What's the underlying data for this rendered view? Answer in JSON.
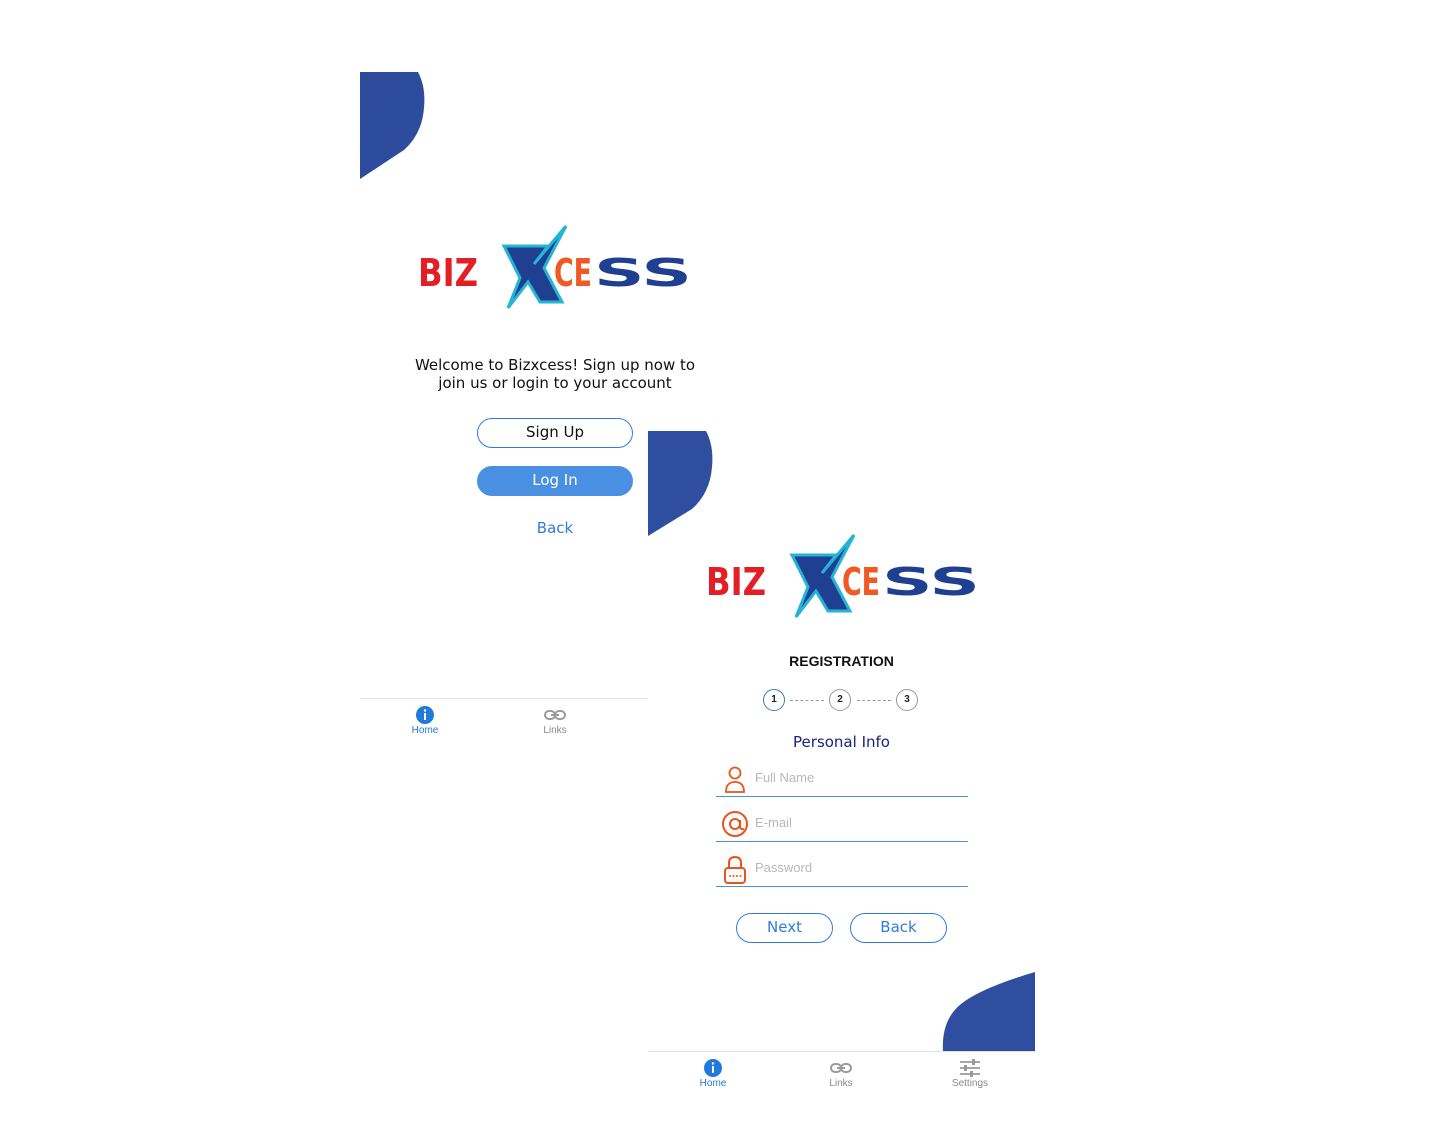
{
  "brand": {
    "logo_parts": [
      "BIZ",
      "X",
      "CESS"
    ],
    "colors": {
      "red": "#e21f26",
      "cyan": "#24b4d6",
      "orange": "#ef5a24",
      "navy": "#1f3f91",
      "accent_blue": "#2f4ea0"
    }
  },
  "screen1": {
    "welcome_text": "Welcome to Bizxcess! Sign up now to join us or login to your account",
    "signup_label": "Sign Up",
    "login_label": "Log In",
    "back_label": "Back",
    "nav": [
      {
        "label": "Home",
        "icon": "info-icon",
        "active": true
      },
      {
        "label": "Links",
        "icon": "link-icon",
        "active": false
      }
    ]
  },
  "screen2": {
    "title": "REGISTRATION",
    "steps": [
      "1",
      "2",
      "3"
    ],
    "active_step": "1",
    "section_title": "Personal Info",
    "fields": [
      {
        "placeholder": "Full Name",
        "icon": "person-icon"
      },
      {
        "placeholder": "E-mail",
        "icon": "at-icon"
      },
      {
        "placeholder": "Password",
        "icon": "lock-icon"
      }
    ],
    "next_label": "Next",
    "back_label": "Back",
    "nav": [
      {
        "label": "Home",
        "icon": "info-icon",
        "active": true
      },
      {
        "label": "Links",
        "icon": "link-icon",
        "active": false
      },
      {
        "label": "Settings",
        "icon": "sliders-icon",
        "active": false
      }
    ]
  }
}
